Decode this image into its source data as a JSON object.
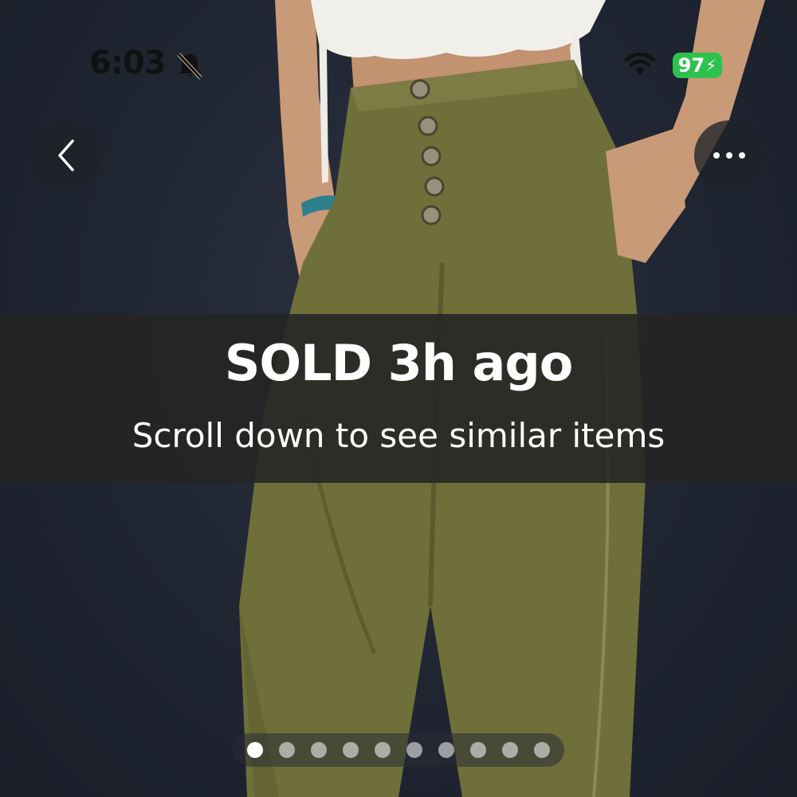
{
  "status_bar": {
    "time": "6:03",
    "battery": "97",
    "icons": [
      "bell-slash-icon",
      "wifi-icon",
      "battery-icon",
      "bolt-icon"
    ],
    "battery_color": "#2fc14e"
  },
  "nav": {
    "back_icon": "chevron-left-icon",
    "more_icon": "more-horizontal-icon"
  },
  "sold_banner": {
    "title": "SOLD 3h ago",
    "subtitle": "Scroll down to see similar items"
  },
  "carousel": {
    "page_count": 10,
    "active_index": 0
  }
}
